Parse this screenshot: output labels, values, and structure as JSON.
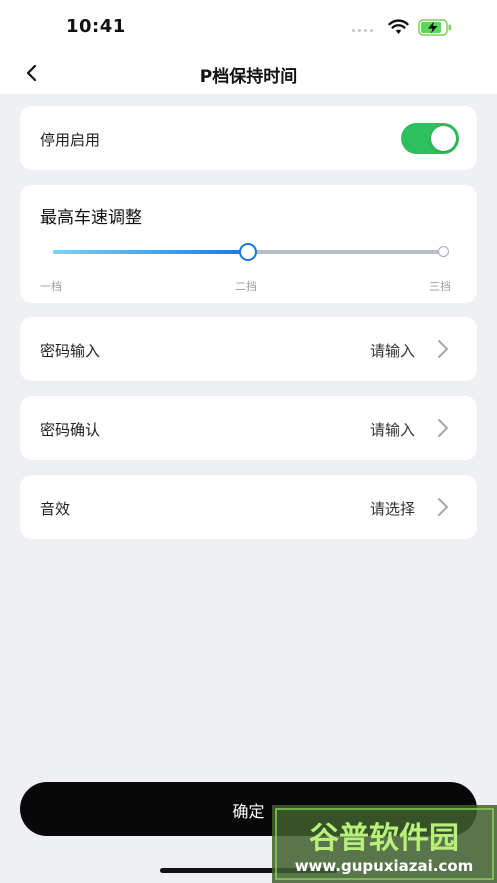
{
  "status_bar": {
    "time": "10:41",
    "wifi_icon": "wifi-icon",
    "battery_icon": "battery-charging-icon"
  },
  "nav": {
    "title": "P档保持时间",
    "back_icon": "chevron-left-icon"
  },
  "toggle_row": {
    "label": "停用启用",
    "enabled": true,
    "accent_color": "#2ec05e"
  },
  "speed_slider": {
    "title": "最高车速调整",
    "ticks": [
      "一档",
      "二挡",
      "三挡"
    ],
    "value_fraction": 0.5,
    "accent_color": "#1677e6"
  },
  "rows": [
    {
      "label": "密码输入",
      "value": "请输入"
    },
    {
      "label": "密码确认",
      "value": "请输入"
    },
    {
      "label": "音效",
      "value": "请选择"
    }
  ],
  "confirm_button": {
    "label": "确定"
  },
  "watermark": {
    "brand": "谷普软件园",
    "url": "www.gupuxiazai.com"
  }
}
